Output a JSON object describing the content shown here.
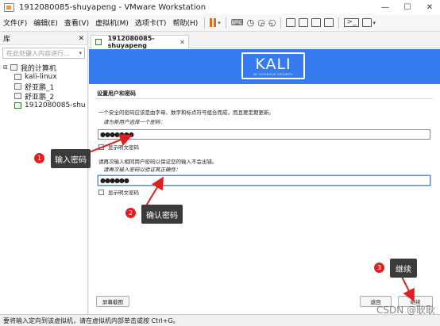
{
  "window": {
    "title": "1912080085-shuyapeng - VMware Workstation",
    "minimize": "—",
    "maximize": "☐",
    "close": "✕"
  },
  "menu": {
    "items": [
      "文件(F)",
      "编辑(E)",
      "查看(V)",
      "虚拟机(M)",
      "选项卡(T)",
      "帮助(H)"
    ]
  },
  "library": {
    "title": "库",
    "close": "✕",
    "search_placeholder": "在此处键入内容进行...",
    "root": "我的计算机",
    "items": [
      "kali-linux",
      "舒亚鹏_1",
      "舒亚鹏_2",
      "1912080085-shu"
    ]
  },
  "tab": {
    "label": "1912080085-shuyapeng",
    "close": "✕"
  },
  "installer": {
    "logo_word": "KALI",
    "logo_sub": "BY OFFENSIVE SECURITY",
    "page_title": "设置用户和密码",
    "intro": "一个安全的密码应该是由字母、数字和标点符号组合而成，而且要定期更新。",
    "new_password_label": "请为新用户选择一个密码：",
    "password_value": "●●●●●●●",
    "show_plain_label": "显示明文密码",
    "confirm_intro": "请再次输入相同用户密码以保证您的输入不会出错。",
    "confirm_label": "请再次输入密码以验证其正确性：",
    "confirm_value": "●●●●●●",
    "show_plain_label2": "显示明文密码",
    "screenshot_button": "屏幕截图",
    "back_button": "返回",
    "continue_button": "继续"
  },
  "annotations": [
    {
      "number": "1",
      "text": "输入密码"
    },
    {
      "number": "2",
      "text": "确认密码"
    },
    {
      "number": "3",
      "text": "继续"
    }
  ],
  "status": {
    "text": "要将输入定向到该虚拟机，请在虚拟机内部单击或按 Ctrl+G。"
  },
  "watermark": "CSDN @耿耿",
  "colors": {
    "banner": "#367bf0",
    "badge": "#e02020",
    "annotation_box": "#3b3b3b",
    "arrow": "#e02020"
  }
}
